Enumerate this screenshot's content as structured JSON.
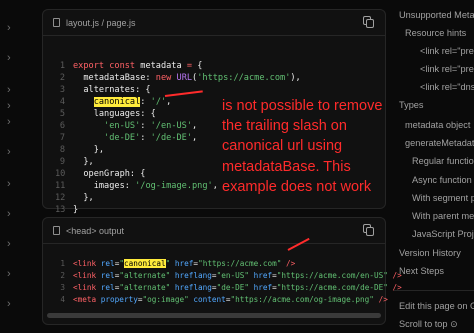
{
  "sidebar": {
    "chevrons": 11
  },
  "code_block_1": {
    "filename": "layout.js / page.js",
    "lines": [
      {
        "n": "1",
        "t": "export const metadata = {"
      },
      {
        "n": "2",
        "t": "metadataBase: new URL('https://acme.com'),"
      },
      {
        "n": "3",
        "t": "alternates: {"
      },
      {
        "n": "4",
        "t": "canonical: '/',"
      },
      {
        "n": "5",
        "t": "languages: {"
      },
      {
        "n": "6",
        "t": "'en-US': '/en-US',"
      },
      {
        "n": "7",
        "t": "'de-DE': '/de-DE',"
      },
      {
        "n": "8",
        "t": "},"
      },
      {
        "n": "9",
        "t": "},"
      },
      {
        "n": "10",
        "t": "openGraph: {"
      },
      {
        "n": "11",
        "t": "images: '/og-image.png',"
      },
      {
        "n": "12",
        "t": "},"
      },
      {
        "n": "13",
        "t": "}"
      }
    ]
  },
  "code_block_2": {
    "filename": "<head> output",
    "lines": [
      {
        "n": "1",
        "t": "<link rel=\"canonical\" href=\"https://acme.com\" />"
      },
      {
        "n": "2",
        "t": "<link rel=\"alternate\" hreflang=\"en-US\" href=\"https://acme.com/en-US\" />"
      },
      {
        "n": "3",
        "t": "<link rel=\"alternate\" hreflang=\"de-DE\" href=\"https://acme.com/de-DE\" />"
      },
      {
        "n": "4",
        "t": "<meta property=\"og:image\" content=\"https://acme.com/og-image.png\" />"
      }
    ]
  },
  "annotation": {
    "text": "is not possible to remove the trailing slash on canonical url using metadataBase. This example does not work",
    "color": "#ff2b2b"
  },
  "toc": {
    "items": [
      "Unsupported Metadata",
      "Resource hints",
      "<link rel=\"preload\">",
      "<link rel=\"prefetch\">",
      "<link rel=\"dns-prefetch\">",
      "Types",
      "metadata object",
      "generateMetadata function",
      "Regular function",
      "Async function",
      "With segment props",
      "With parent metadata",
      "JavaScript Projects",
      "Version History",
      "Next Steps",
      "Edit this page on GitHub",
      "Scroll to top"
    ]
  },
  "colors": {
    "background": "#0a0a0a",
    "highlight": "#ffeb3b",
    "keyword": "#ff6166",
    "string": "#62c073"
  }
}
